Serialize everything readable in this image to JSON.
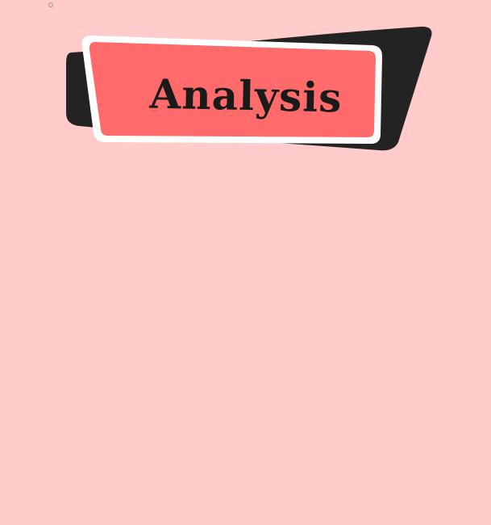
{
  "banner": {
    "title": "Analysis"
  },
  "colors": {
    "background": "#FFCCCB",
    "banner_fill": "#FF6B6B",
    "banner_border": "#FFFFFF",
    "banner_shadow": "#232323",
    "title_text": "#1A1A1A"
  }
}
